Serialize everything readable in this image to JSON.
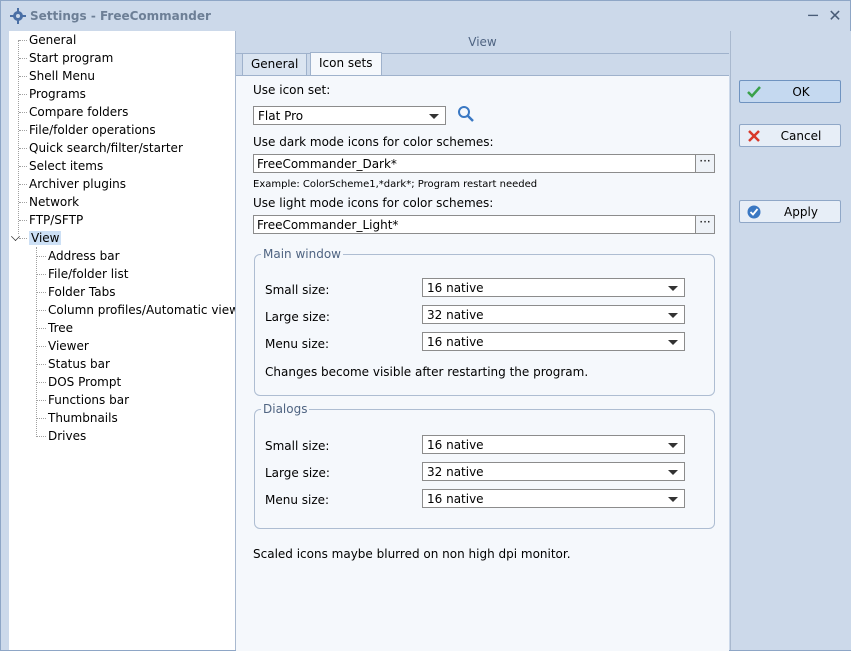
{
  "window": {
    "title": "Settings - FreeCommander",
    "minimize": "─",
    "close": "✕"
  },
  "tree": {
    "items": [
      {
        "label": "General",
        "level": 0
      },
      {
        "label": "Start program",
        "level": 0
      },
      {
        "label": "Shell Menu",
        "level": 0
      },
      {
        "label": "Programs",
        "level": 0
      },
      {
        "label": "Compare folders",
        "level": 0
      },
      {
        "label": "File/folder operations",
        "level": 0
      },
      {
        "label": "Quick search/filter/starter",
        "level": 0
      },
      {
        "label": "Select items",
        "level": 0
      },
      {
        "label": "Archiver plugins",
        "level": 0
      },
      {
        "label": "Network",
        "level": 0
      },
      {
        "label": "FTP/SFTP",
        "level": 0
      },
      {
        "label": "View",
        "level": 0,
        "expanded": true,
        "selected": true
      },
      {
        "label": "Address bar",
        "level": 1
      },
      {
        "label": "File/folder list",
        "level": 1
      },
      {
        "label": "Folder Tabs",
        "level": 1
      },
      {
        "label": "Column profiles/Automatic views",
        "level": 1
      },
      {
        "label": "Tree",
        "level": 1
      },
      {
        "label": "Viewer",
        "level": 1
      },
      {
        "label": "Status bar",
        "level": 1
      },
      {
        "label": "DOS Prompt",
        "level": 1
      },
      {
        "label": "Functions bar",
        "level": 1
      },
      {
        "label": "Thumbnails",
        "level": 1
      },
      {
        "label": "Drives",
        "level": 1
      }
    ]
  },
  "panel": {
    "title": "View",
    "tabs": [
      "General",
      "Icon sets"
    ],
    "active_tab": "Icon sets"
  },
  "icon_sets": {
    "use_icon_set_label": "Use icon set:",
    "use_icon_set_value": "Flat Pro",
    "dark_label": "Use dark mode icons for color schemes:",
    "dark_value": "FreeCommander_Dark*",
    "example_note": "Example: ColorScheme1,*dark*; Program restart needed",
    "light_label": "Use light mode icons for color schemes:",
    "light_value": "FreeCommander_Light*",
    "ellipsis": "···",
    "main_window": {
      "title": "Main window",
      "small_label": "Small size:",
      "small_value": "16 native",
      "large_label": "Large size:",
      "large_value": "32 native",
      "menu_label": "Menu size:",
      "menu_value": "16 native",
      "note": "Changes become visible after restarting the program."
    },
    "dialogs": {
      "title": "Dialogs",
      "small_label": "Small size:",
      "small_value": "16 native",
      "large_label": "Large size:",
      "large_value": "32 native",
      "menu_label": "Menu size:",
      "menu_value": "16 native"
    },
    "footer_note": "Scaled icons maybe blurred on non high dpi monitor."
  },
  "buttons": {
    "ok": "OK",
    "cancel": "Cancel",
    "apply": "Apply"
  },
  "colors": {
    "accent": "#3a78c3",
    "ok_check": "#3aa14b",
    "cancel_x": "#d8392b"
  }
}
